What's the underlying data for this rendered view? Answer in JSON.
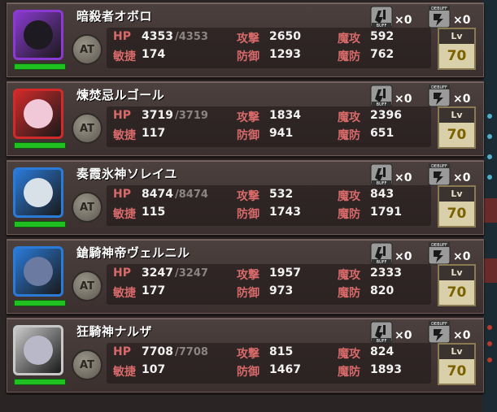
{
  "labels": {
    "hp": "HP",
    "agi": "敏捷",
    "atk": "攻撃",
    "def": "防御",
    "matk": "魔攻",
    "mdef": "魔防",
    "lv": "Lv",
    "at": "AT",
    "buff": "BUFF",
    "debuff": "DEBUFF"
  },
  "units": [
    {
      "name": "暗殺者オボロ",
      "hp": "4353",
      "hp_max": "/4353",
      "agi": "174",
      "atk": "2650",
      "def": "1293",
      "matk": "592",
      "mdef": "762",
      "lv": "70",
      "buff": "×0",
      "debuff": "×0",
      "frame_color": "#8a3ad0",
      "hp_fill": 1.0
    },
    {
      "name": "煉焚忌ルゴール",
      "hp": "3719",
      "hp_max": "/3719",
      "agi": "117",
      "atk": "1834",
      "def": "941",
      "matk": "2396",
      "mdef": "651",
      "lv": "70",
      "buff": "×0",
      "debuff": "×0",
      "frame_color": "#d02a2a",
      "hp_fill": 1.0
    },
    {
      "name": "奏霞氷神ソレイユ",
      "hp": "8474",
      "hp_max": "/8474",
      "agi": "115",
      "atk": "532",
      "def": "1743",
      "matk": "843",
      "mdef": "1791",
      "lv": "70",
      "buff": "×0",
      "debuff": "×0",
      "frame_color": "#2a7ad8",
      "hp_fill": 1.0
    },
    {
      "name": "鎗騎神帝ヴェルニル",
      "hp": "3247",
      "hp_max": "/3247",
      "agi": "177",
      "atk": "1957",
      "def": "973",
      "matk": "2333",
      "mdef": "820",
      "lv": "70",
      "buff": "×0",
      "debuff": "×0",
      "frame_color": "#2a7ad8",
      "hp_fill": 1.0
    },
    {
      "name": "狂騎神ナルザ",
      "hp": "7708",
      "hp_max": "/7708",
      "agi": "107",
      "atk": "815",
      "def": "1467",
      "matk": "824",
      "mdef": "1893",
      "lv": "70",
      "buff": "×0",
      "debuff": "×0",
      "frame_color": "#c8c8c8",
      "hp_fill": 1.0
    }
  ]
}
